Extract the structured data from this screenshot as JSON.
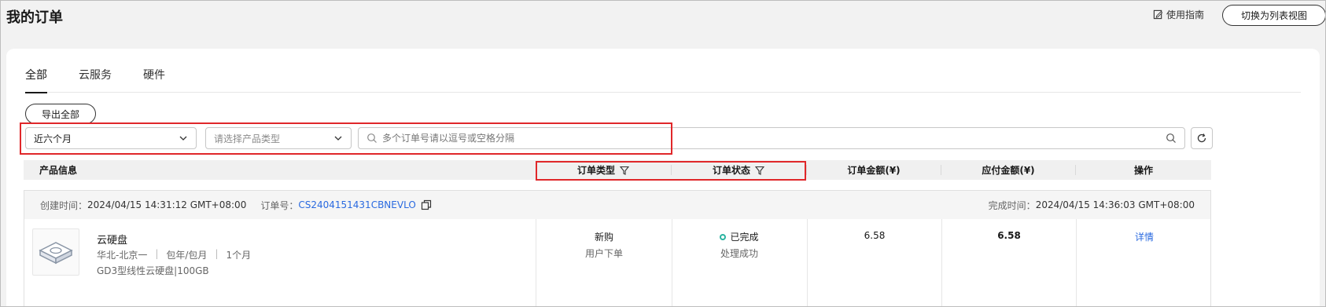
{
  "header": {
    "title": "我的订单",
    "guide_label": "使用指南",
    "switch_view_label": "切换为列表视图"
  },
  "tabs": [
    {
      "label": "全部",
      "active": true
    },
    {
      "label": "云服务",
      "active": false
    },
    {
      "label": "硬件",
      "active": false
    }
  ],
  "toolbar": {
    "export_label": "导出全部"
  },
  "filters": {
    "time_range_value": "近六个月",
    "product_type_placeholder": "请选择产品类型",
    "search_placeholder": "多个订单号请以逗号或空格分隔"
  },
  "table": {
    "columns": [
      "产品信息",
      "订单类型",
      "订单状态",
      "订单金额(¥)",
      "应付金额(¥)",
      "操作"
    ]
  },
  "order": {
    "created_label": "创建时间：",
    "created_time": "2024/04/15 14:31:12 GMT+08:00",
    "order_no_label": "订单号：",
    "order_no": "CS2404151431CBNEVLO",
    "finished_label": "完成时间：",
    "finished_time": "2024/04/15 14:36:03 GMT+08:00",
    "product_name": "云硬盘",
    "region": "华北-北京一",
    "billing": "包年/包月",
    "duration": "1个月",
    "spec": "GD3型线性云硬盘|100GB",
    "order_type": "新购",
    "order_type_sub": "用户下单",
    "status": "已完成",
    "status_sub": "处理成功",
    "status_color": "#2ab3a0",
    "amount": "6.58",
    "payable": "6.58",
    "action_label": "详情"
  },
  "colors": {
    "highlight": "#e0272a",
    "link": "#2a6ae0"
  }
}
